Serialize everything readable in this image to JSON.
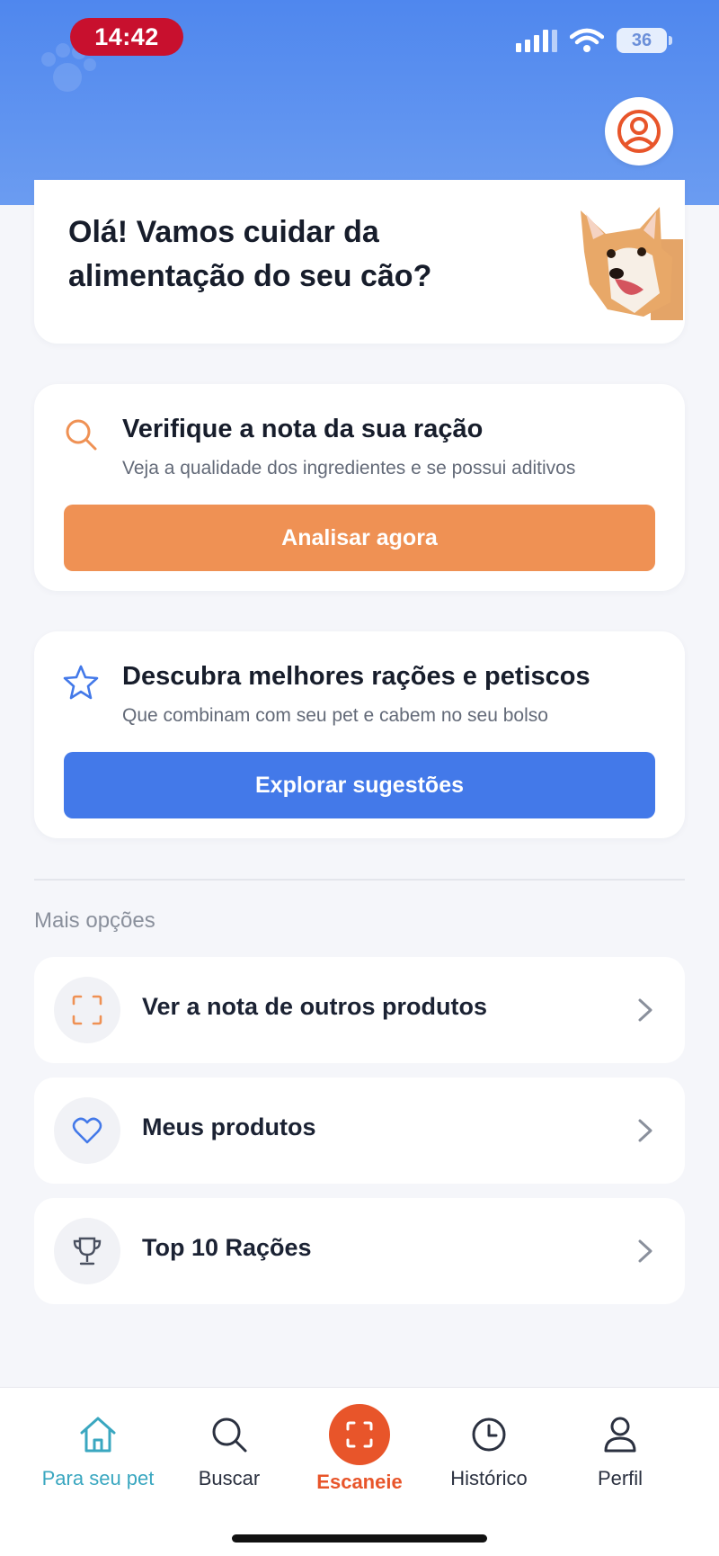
{
  "status_bar": {
    "time": "14:42",
    "battery": "36"
  },
  "header": {
    "profile_icon": "user-circle-icon"
  },
  "greeting": {
    "text": "Olá! Vamos cuidar da alimentação do seu cão?"
  },
  "cards": [
    {
      "icon": "search-icon",
      "title": "Verifique a nota da sua ração",
      "subtitle": "Veja a qualidade dos ingredientes e se possui aditivos",
      "button_label": "Analisar agora",
      "button_color": "#ef9154"
    },
    {
      "icon": "star-icon",
      "title": "Descubra melhores rações e petiscos",
      "subtitle": "Que combinam com seu pet e cabem no seu bolso",
      "button_label": "Explorar sugestões",
      "button_color": "#4379e9"
    }
  ],
  "more_options": {
    "label": "Mais opções",
    "items": [
      {
        "label": "Ver a nota de outros produtos",
        "icon": "scan-frame-icon"
      },
      {
        "label": "Meus produtos",
        "icon": "heart-icon"
      },
      {
        "label": "Top 10 Rações",
        "icon": "trophy-icon"
      }
    ]
  },
  "bottom_nav": [
    {
      "label": "Para seu pet",
      "icon": "home-icon",
      "active": true
    },
    {
      "label": "Buscar",
      "icon": "search-icon"
    },
    {
      "label": "Escaneie",
      "icon": "scan-icon"
    },
    {
      "label": "Histórico",
      "icon": "clock-icon"
    },
    {
      "label": "Perfil",
      "icon": "person-icon"
    }
  ],
  "colors": {
    "header": "#4f87ee",
    "accent_orange": "#ef9154",
    "accent_blue": "#4379e9",
    "scan": "#e8552a",
    "active_nav": "#3aa7c0"
  }
}
